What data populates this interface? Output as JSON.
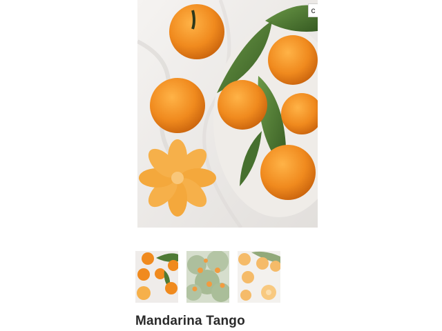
{
  "gallery": {
    "main_image": {
      "alt": ""
    },
    "zoom_button": {
      "label": "c"
    },
    "thumbnails": [
      {
        "subject": "mandarins-on-cloth"
      },
      {
        "subject": "mandarin-tree"
      },
      {
        "subject": "mandarin-halves"
      }
    ]
  },
  "product": {
    "title": "Mandarina Tango"
  },
  "colors": {
    "orange": "#f0922a",
    "leaf": "#4f7a35",
    "cloth": "#ece9e6"
  }
}
